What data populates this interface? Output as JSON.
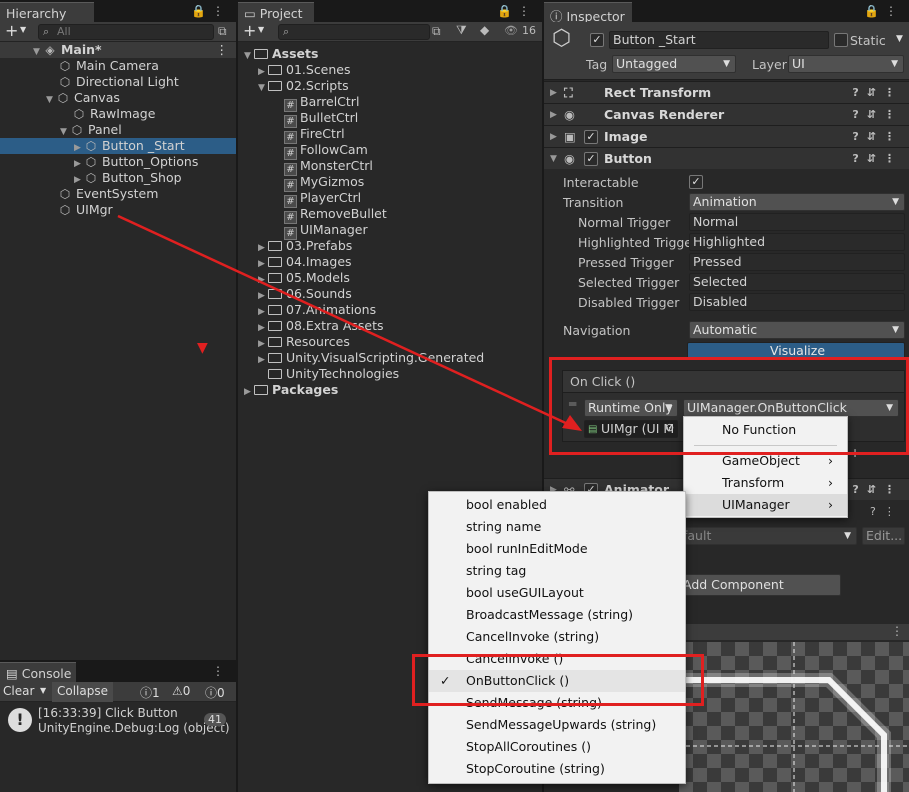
{
  "hierarchy": {
    "tab": "Hierarchy",
    "search_placeholder": "All",
    "scene": "Main*",
    "items": [
      {
        "label": "Main Camera"
      },
      {
        "label": "Directional Light"
      },
      {
        "label": "Canvas"
      },
      {
        "label": "RawImage"
      },
      {
        "label": "Panel"
      },
      {
        "label": "Button _Start"
      },
      {
        "label": "Button_Options"
      },
      {
        "label": "Button_Shop"
      },
      {
        "label": "EventSystem"
      },
      {
        "label": "UIMgr"
      }
    ]
  },
  "project": {
    "tab": "Project",
    "count": "16",
    "assets_label": "Assets",
    "folders": [
      {
        "label": "01.Scenes"
      },
      {
        "label": "02.Scripts"
      }
    ],
    "scripts": [
      "BarrelCtrl",
      "BulletCtrl",
      "FireCtrl",
      "FollowCam",
      "MonsterCtrl",
      "MyGizmos",
      "PlayerCtrl",
      "RemoveBullet",
      "UIManager"
    ],
    "more_folders": [
      "03.Prefabs",
      "04.Images",
      "05.Models",
      "06.Sounds",
      "07.Animations",
      "08.Extra Assets",
      "Resources",
      "Unity.VisualScripting.Generated",
      "UnityTechnologies"
    ],
    "packages_label": "Packages"
  },
  "console": {
    "tab": "Console",
    "clear": "Clear",
    "collapse": "Collapse",
    "counts": [
      "1",
      "0",
      "0"
    ],
    "log_line1": "[16:33:39] Click Button",
    "log_line2": "UnityEngine.Debug:Log (object)",
    "badge": "41"
  },
  "inspector": {
    "tab": "Inspector",
    "name": "Button _Start",
    "static_label": "Static",
    "tag_label": "Tag",
    "tag_value": "Untagged",
    "layer_label": "Layer",
    "layer_value": "UI",
    "components": {
      "rect": "Rect Transform",
      "canvas": "Canvas Renderer",
      "image": "Image",
      "button": "Button",
      "animator": "Animator"
    },
    "interactable_label": "Interactable",
    "transition_label": "Transition",
    "transition_value": "Animation",
    "triggers": [
      {
        "label": "Normal Trigger",
        "value": "Normal"
      },
      {
        "label": "Highlighted Trigger",
        "value": "Highlighted"
      },
      {
        "label": "Pressed Trigger",
        "value": "Pressed"
      },
      {
        "label": "Selected Trigger",
        "value": "Selected"
      },
      {
        "label": "Disabled Trigger",
        "value": "Disabled"
      }
    ],
    "navigation_label": "Navigation",
    "navigation_value": "Automatic",
    "visualize": "Visualize",
    "onclick_header": "On Click ()",
    "runtime": "Runtime Only",
    "function": "UIManager.OnButtonClick",
    "object": "UIMgr (UI M",
    "default_text": "fault",
    "edit": "Edit...",
    "add_component": "Add Component",
    "plus": "+",
    "minus": "−"
  },
  "function_menu": {
    "no_function": "No Function",
    "items": [
      "GameObject",
      "Transform",
      "UIManager"
    ]
  },
  "submenu": {
    "items": [
      "bool enabled",
      "string name",
      "bool runInEditMode",
      "string tag",
      "bool useGUILayout",
      "BroadcastMessage (string)",
      "CancelInvoke (string)",
      "CancelInvoke ()",
      "OnButtonClick ()",
      "SendMessage (string)",
      "SendMessageUpwards (string)",
      "StopAllCoroutines ()",
      "StopCoroutine (string)"
    ],
    "checked_index": 8
  },
  "colors": {
    "selection": "#2c5d87",
    "annotation": "#e02020",
    "accent_button": "#2c5d87"
  }
}
